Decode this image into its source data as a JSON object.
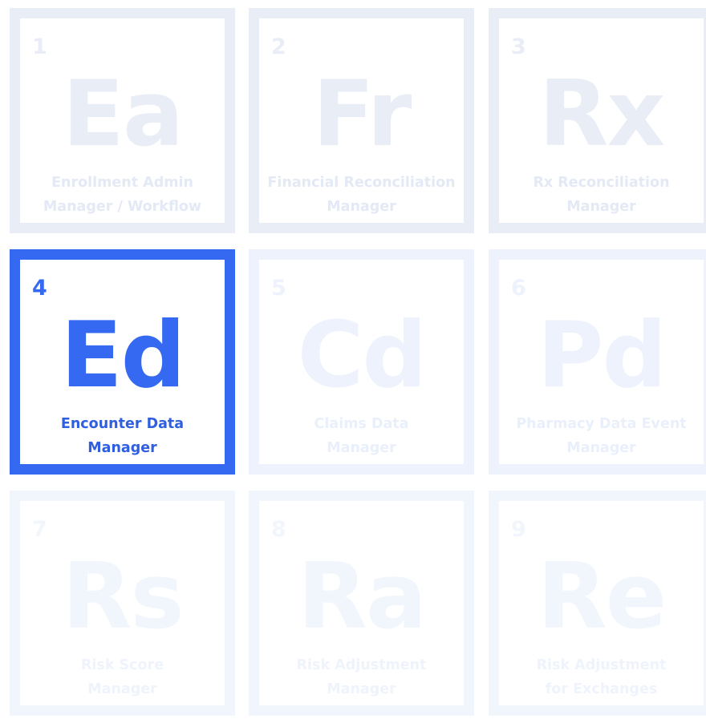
{
  "tiles": [
    {
      "number": "1",
      "symbol": "Ea",
      "name_line1": "Enrollment Admin",
      "name_line2": "Manager / Workflow",
      "active": false
    },
    {
      "number": "2",
      "symbol": "Fr",
      "name_line1": "Financial Reconciliation",
      "name_line2": "Manager",
      "active": false
    },
    {
      "number": "3",
      "symbol": "Rx",
      "name_line1": "Rx Reconciliation",
      "name_line2": "Manager",
      "active": false
    },
    {
      "number": "4",
      "symbol": "Ed",
      "name_line1": "Encounter Data",
      "name_line2": "Manager",
      "active": true
    },
    {
      "number": "5",
      "symbol": "Cd",
      "name_line1": "Claims Data",
      "name_line2": "Manager",
      "active": false
    },
    {
      "number": "6",
      "symbol": "Pd",
      "name_line1": "Pharmacy Data Event",
      "name_line2": "Manager",
      "active": false
    },
    {
      "number": "7",
      "symbol": "Rs",
      "name_line1": "Risk Score",
      "name_line2": "Manager",
      "active": false
    },
    {
      "number": "8",
      "symbol": "Ra",
      "name_line1": "Risk Adjustment",
      "name_line2": "Manager",
      "active": false
    },
    {
      "number": "9",
      "symbol": "Re",
      "name_line1": "Risk Adjustment",
      "name_line2": "for Exchanges",
      "active": false
    }
  ],
  "colors": {
    "active_accent": "#3569f2",
    "inactive_row1": "#e9edf6",
    "inactive_row2": "#edf2fd",
    "inactive_row3": "#f1f6fd"
  }
}
